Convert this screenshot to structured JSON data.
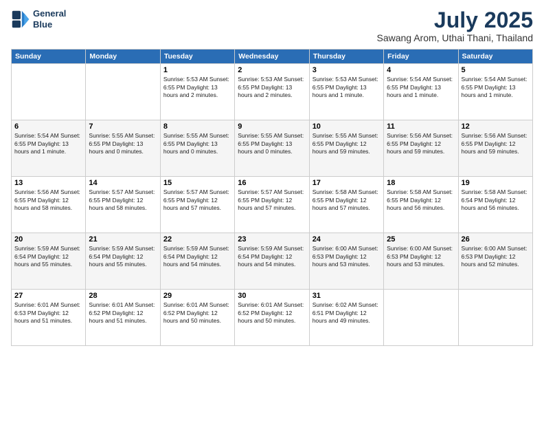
{
  "header": {
    "logo_line1": "General",
    "logo_line2": "Blue",
    "month": "July 2025",
    "location": "Sawang Arom, Uthai Thani, Thailand"
  },
  "weekdays": [
    "Sunday",
    "Monday",
    "Tuesday",
    "Wednesday",
    "Thursday",
    "Friday",
    "Saturday"
  ],
  "weeks": [
    [
      {
        "day": "",
        "info": ""
      },
      {
        "day": "",
        "info": ""
      },
      {
        "day": "1",
        "info": "Sunrise: 5:53 AM\nSunset: 6:55 PM\nDaylight: 13 hours and 2 minutes."
      },
      {
        "day": "2",
        "info": "Sunrise: 5:53 AM\nSunset: 6:55 PM\nDaylight: 13 hours and 2 minutes."
      },
      {
        "day": "3",
        "info": "Sunrise: 5:53 AM\nSunset: 6:55 PM\nDaylight: 13 hours and 1 minute."
      },
      {
        "day": "4",
        "info": "Sunrise: 5:54 AM\nSunset: 6:55 PM\nDaylight: 13 hours and 1 minute."
      },
      {
        "day": "5",
        "info": "Sunrise: 5:54 AM\nSunset: 6:55 PM\nDaylight: 13 hours and 1 minute."
      }
    ],
    [
      {
        "day": "6",
        "info": "Sunrise: 5:54 AM\nSunset: 6:55 PM\nDaylight: 13 hours and 1 minute."
      },
      {
        "day": "7",
        "info": "Sunrise: 5:55 AM\nSunset: 6:55 PM\nDaylight: 13 hours and 0 minutes."
      },
      {
        "day": "8",
        "info": "Sunrise: 5:55 AM\nSunset: 6:55 PM\nDaylight: 13 hours and 0 minutes."
      },
      {
        "day": "9",
        "info": "Sunrise: 5:55 AM\nSunset: 6:55 PM\nDaylight: 13 hours and 0 minutes."
      },
      {
        "day": "10",
        "info": "Sunrise: 5:55 AM\nSunset: 6:55 PM\nDaylight: 12 hours and 59 minutes."
      },
      {
        "day": "11",
        "info": "Sunrise: 5:56 AM\nSunset: 6:55 PM\nDaylight: 12 hours and 59 minutes."
      },
      {
        "day": "12",
        "info": "Sunrise: 5:56 AM\nSunset: 6:55 PM\nDaylight: 12 hours and 59 minutes."
      }
    ],
    [
      {
        "day": "13",
        "info": "Sunrise: 5:56 AM\nSunset: 6:55 PM\nDaylight: 12 hours and 58 minutes."
      },
      {
        "day": "14",
        "info": "Sunrise: 5:57 AM\nSunset: 6:55 PM\nDaylight: 12 hours and 58 minutes."
      },
      {
        "day": "15",
        "info": "Sunrise: 5:57 AM\nSunset: 6:55 PM\nDaylight: 12 hours and 57 minutes."
      },
      {
        "day": "16",
        "info": "Sunrise: 5:57 AM\nSunset: 6:55 PM\nDaylight: 12 hours and 57 minutes."
      },
      {
        "day": "17",
        "info": "Sunrise: 5:58 AM\nSunset: 6:55 PM\nDaylight: 12 hours and 57 minutes."
      },
      {
        "day": "18",
        "info": "Sunrise: 5:58 AM\nSunset: 6:55 PM\nDaylight: 12 hours and 56 minutes."
      },
      {
        "day": "19",
        "info": "Sunrise: 5:58 AM\nSunset: 6:54 PM\nDaylight: 12 hours and 56 minutes."
      }
    ],
    [
      {
        "day": "20",
        "info": "Sunrise: 5:59 AM\nSunset: 6:54 PM\nDaylight: 12 hours and 55 minutes."
      },
      {
        "day": "21",
        "info": "Sunrise: 5:59 AM\nSunset: 6:54 PM\nDaylight: 12 hours and 55 minutes."
      },
      {
        "day": "22",
        "info": "Sunrise: 5:59 AM\nSunset: 6:54 PM\nDaylight: 12 hours and 54 minutes."
      },
      {
        "day": "23",
        "info": "Sunrise: 5:59 AM\nSunset: 6:54 PM\nDaylight: 12 hours and 54 minutes."
      },
      {
        "day": "24",
        "info": "Sunrise: 6:00 AM\nSunset: 6:53 PM\nDaylight: 12 hours and 53 minutes."
      },
      {
        "day": "25",
        "info": "Sunrise: 6:00 AM\nSunset: 6:53 PM\nDaylight: 12 hours and 53 minutes."
      },
      {
        "day": "26",
        "info": "Sunrise: 6:00 AM\nSunset: 6:53 PM\nDaylight: 12 hours and 52 minutes."
      }
    ],
    [
      {
        "day": "27",
        "info": "Sunrise: 6:01 AM\nSunset: 6:53 PM\nDaylight: 12 hours and 51 minutes."
      },
      {
        "day": "28",
        "info": "Sunrise: 6:01 AM\nSunset: 6:52 PM\nDaylight: 12 hours and 51 minutes."
      },
      {
        "day": "29",
        "info": "Sunrise: 6:01 AM\nSunset: 6:52 PM\nDaylight: 12 hours and 50 minutes."
      },
      {
        "day": "30",
        "info": "Sunrise: 6:01 AM\nSunset: 6:52 PM\nDaylight: 12 hours and 50 minutes."
      },
      {
        "day": "31",
        "info": "Sunrise: 6:02 AM\nSunset: 6:51 PM\nDaylight: 12 hours and 49 minutes."
      },
      {
        "day": "",
        "info": ""
      },
      {
        "day": "",
        "info": ""
      }
    ]
  ]
}
